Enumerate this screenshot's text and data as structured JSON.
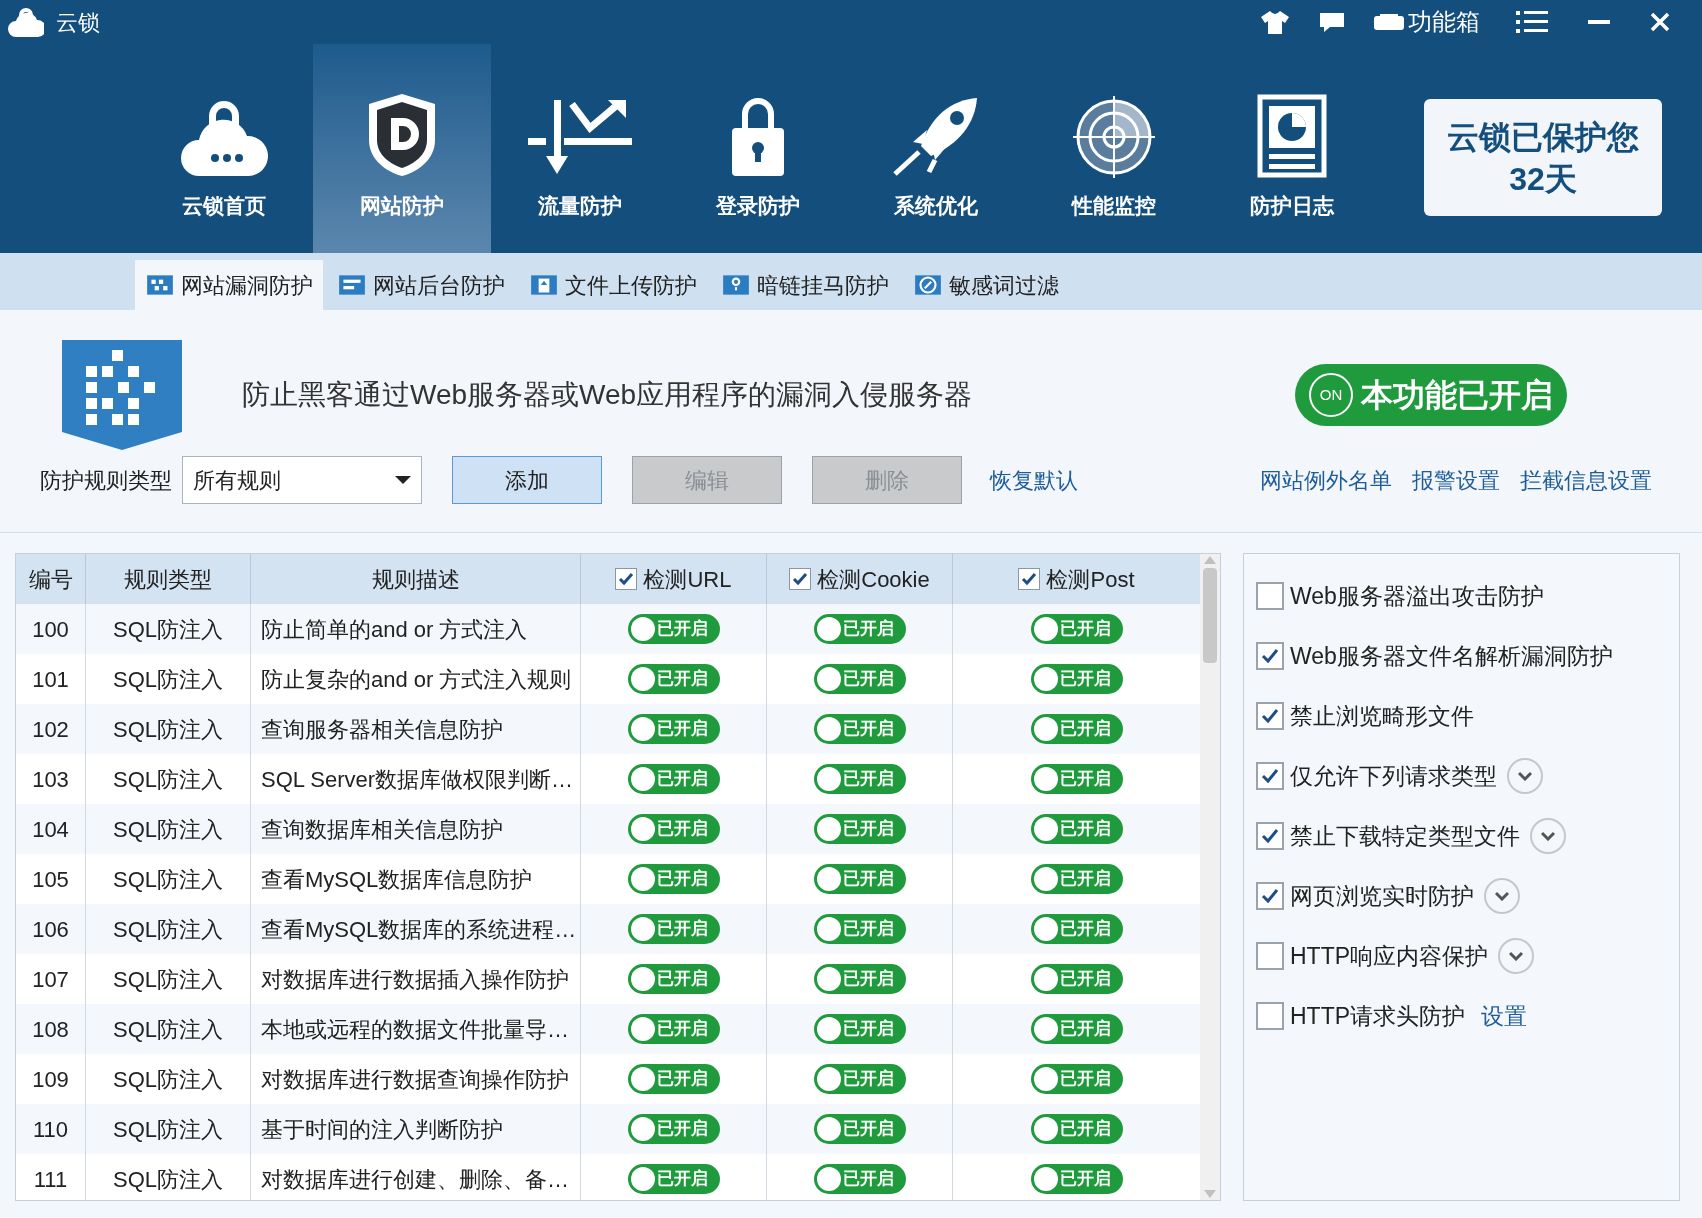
{
  "window": {
    "title": "云锁",
    "toolbox_label": "功能箱"
  },
  "nav": [
    {
      "label": "云锁首页",
      "kind": "cloud",
      "selected": false
    },
    {
      "label": "网站防护",
      "kind": "shield",
      "selected": true
    },
    {
      "label": "流量防护",
      "kind": "traffic",
      "selected": false
    },
    {
      "label": "登录防护",
      "kind": "lock",
      "selected": false
    },
    {
      "label": "系统优化",
      "kind": "rocket",
      "selected": false
    },
    {
      "label": "性能监控",
      "kind": "radar",
      "selected": false
    },
    {
      "label": "防护日志",
      "kind": "log",
      "selected": false
    }
  ],
  "protection_badge": {
    "line_1": "云锁已保护您",
    "line_2": "32天"
  },
  "subtabs": [
    {
      "label": "网站漏洞防护",
      "selected": true
    },
    {
      "label": "网站后台防护",
      "selected": false
    },
    {
      "label": "文件上传防护",
      "selected": false
    },
    {
      "label": "暗链挂马防护",
      "selected": false
    },
    {
      "label": "敏感词过滤",
      "selected": false
    }
  ],
  "feature": {
    "description": "防止黑客通过Web服务器或Web应用程序的漏洞入侵服务器",
    "switch_on": true,
    "switch_badge": "ON",
    "switch_label": "本功能已开启"
  },
  "filter": {
    "label": "防护规则类型",
    "value": "所有规则"
  },
  "buttons": [
    {
      "label": "添加",
      "disabled": false
    },
    {
      "label": "编辑",
      "disabled": true
    },
    {
      "label": "删除",
      "disabled": true
    }
  ],
  "restore_link": "恢复默认",
  "links": [
    "网站例外名单",
    "报警设置",
    "拦截信息设置"
  ],
  "table": {
    "columns": [
      {
        "label": "编号"
      },
      {
        "label": "规则类型"
      },
      {
        "label": "规则描述"
      },
      {
        "label": "检测URL",
        "checked": true
      },
      {
        "label": "检测Cookie",
        "checked": true
      },
      {
        "label": "检测Post",
        "checked": true
      }
    ],
    "rows": [
      {
        "cells": [
          "100",
          "SQL防注入",
          "防止简单的and or 方式注入"
        ],
        "toggles": [
          {
            "on": true,
            "label": "已开启"
          },
          {
            "on": true,
            "label": "已开启"
          },
          {
            "on": true,
            "label": "已开启"
          }
        ]
      },
      {
        "cells": [
          "101",
          "SQL防注入",
          "防止复杂的and or 方式注入规则"
        ],
        "toggles": [
          {
            "on": true,
            "label": "已开启"
          },
          {
            "on": true,
            "label": "已开启"
          },
          {
            "on": true,
            "label": "已开启"
          }
        ]
      },
      {
        "cells": [
          "102",
          "SQL防注入",
          "查询服务器相关信息防护"
        ],
        "toggles": [
          {
            "on": true,
            "label": "已开启"
          },
          {
            "on": true,
            "label": "已开启"
          },
          {
            "on": true,
            "label": "已开启"
          }
        ]
      },
      {
        "cells": [
          "103",
          "SQL防注入",
          "SQL Server数据库做权限判断…"
        ],
        "toggles": [
          {
            "on": true,
            "label": "已开启"
          },
          {
            "on": true,
            "label": "已开启"
          },
          {
            "on": true,
            "label": "已开启"
          }
        ]
      },
      {
        "cells": [
          "104",
          "SQL防注入",
          "查询数据库相关信息防护"
        ],
        "toggles": [
          {
            "on": true,
            "label": "已开启"
          },
          {
            "on": true,
            "label": "已开启"
          },
          {
            "on": true,
            "label": "已开启"
          }
        ]
      },
      {
        "cells": [
          "105",
          "SQL防注入",
          "查看MySQL数据库信息防护"
        ],
        "toggles": [
          {
            "on": true,
            "label": "已开启"
          },
          {
            "on": true,
            "label": "已开启"
          },
          {
            "on": true,
            "label": "已开启"
          }
        ]
      },
      {
        "cells": [
          "106",
          "SQL防注入",
          "查看MySQL数据库的系统进程…"
        ],
        "toggles": [
          {
            "on": true,
            "label": "已开启"
          },
          {
            "on": true,
            "label": "已开启"
          },
          {
            "on": true,
            "label": "已开启"
          }
        ]
      },
      {
        "cells": [
          "107",
          "SQL防注入",
          "对数据库进行数据插入操作防护"
        ],
        "toggles": [
          {
            "on": true,
            "label": "已开启"
          },
          {
            "on": true,
            "label": "已开启"
          },
          {
            "on": true,
            "label": "已开启"
          }
        ]
      },
      {
        "cells": [
          "108",
          "SQL防注入",
          "本地或远程的数据文件批量导…"
        ],
        "toggles": [
          {
            "on": true,
            "label": "已开启"
          },
          {
            "on": true,
            "label": "已开启"
          },
          {
            "on": true,
            "label": "已开启"
          }
        ]
      },
      {
        "cells": [
          "109",
          "SQL防注入",
          "对数据库进行数据查询操作防护"
        ],
        "toggles": [
          {
            "on": true,
            "label": "已开启"
          },
          {
            "on": true,
            "label": "已开启"
          },
          {
            "on": true,
            "label": "已开启"
          }
        ]
      },
      {
        "cells": [
          "110",
          "SQL防注入",
          "基于时间的注入判断防护"
        ],
        "toggles": [
          {
            "on": true,
            "label": "已开启"
          },
          {
            "on": true,
            "label": "已开启"
          },
          {
            "on": true,
            "label": "已开启"
          }
        ]
      },
      {
        "cells": [
          "111",
          "SQL防注入",
          "对数据库进行创建、删除、备…"
        ],
        "toggles": [
          {
            "on": true,
            "label": "已开启"
          },
          {
            "on": true,
            "label": "已开启"
          },
          {
            "on": true,
            "label": "已开启"
          }
        ]
      }
    ]
  },
  "options": [
    {
      "label": "Web服务器溢出攻击防护",
      "checked": false,
      "kind": "plain"
    },
    {
      "label": "Web服务器文件名解析漏洞防护",
      "checked": true,
      "kind": "plain"
    },
    {
      "label": "禁止浏览畸形文件",
      "checked": true,
      "kind": "plain"
    },
    {
      "label": "仅允许下列请求类型",
      "checked": true,
      "kind": "expander"
    },
    {
      "label": "禁止下载特定类型文件",
      "checked": true,
      "kind": "expander"
    },
    {
      "label": "网页浏览实时防护",
      "checked": true,
      "kind": "expander"
    },
    {
      "label": "HTTP响应内容保护",
      "checked": false,
      "kind": "expander"
    },
    {
      "label": "HTTP请求头防护",
      "checked": false,
      "kind": "link",
      "link": "设置"
    }
  ]
}
